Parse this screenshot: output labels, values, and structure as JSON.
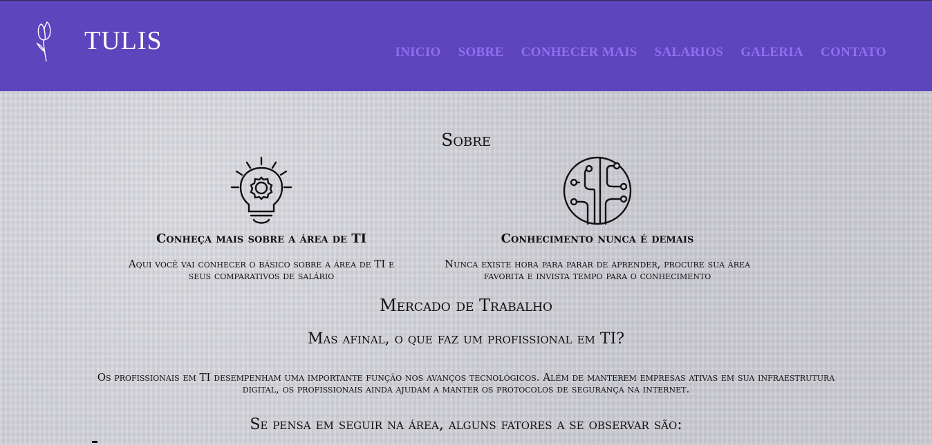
{
  "header": {
    "brand": "TULIS",
    "logo_icon": "tulip-icon",
    "nav": [
      "INICIO",
      "SOBRE",
      "CONHECER MAIS",
      "SALARIOS",
      "GALERIA",
      "CONTATO"
    ],
    "colors": {
      "header_bg": "#5c45bd",
      "nav_link": "#8f6ff0"
    }
  },
  "sobre": {
    "title": "Sobre",
    "features": [
      {
        "icon": "lightbulb-gear-icon",
        "title": "Conheça mais sobre a área de TI",
        "text": "Aqui você vai conhecer o básico sobre a área de TI e seus comparativos de salário"
      },
      {
        "icon": "circuit-circle-icon",
        "title": "Conhecimento nunca é demais",
        "text": "Nunca existe hora para parar de aprender, procure sua área favorita e invista tempo para o conhecimento"
      }
    ]
  },
  "mercado": {
    "title": "Mercado de Trabalho",
    "question": "Mas afinal, o que faz um profissional em TI?",
    "description": "Os profissionais em TI desempenham uma importante função nos avanços tecnológicos. Além de manterem empresas ativas em sua infraestrutura digital, os profissionais ainda ajudam a manter os protocolos de segurança na internet.",
    "factors_title": "Se pensa em seguir na área, alguns fatores a se observar são:"
  }
}
